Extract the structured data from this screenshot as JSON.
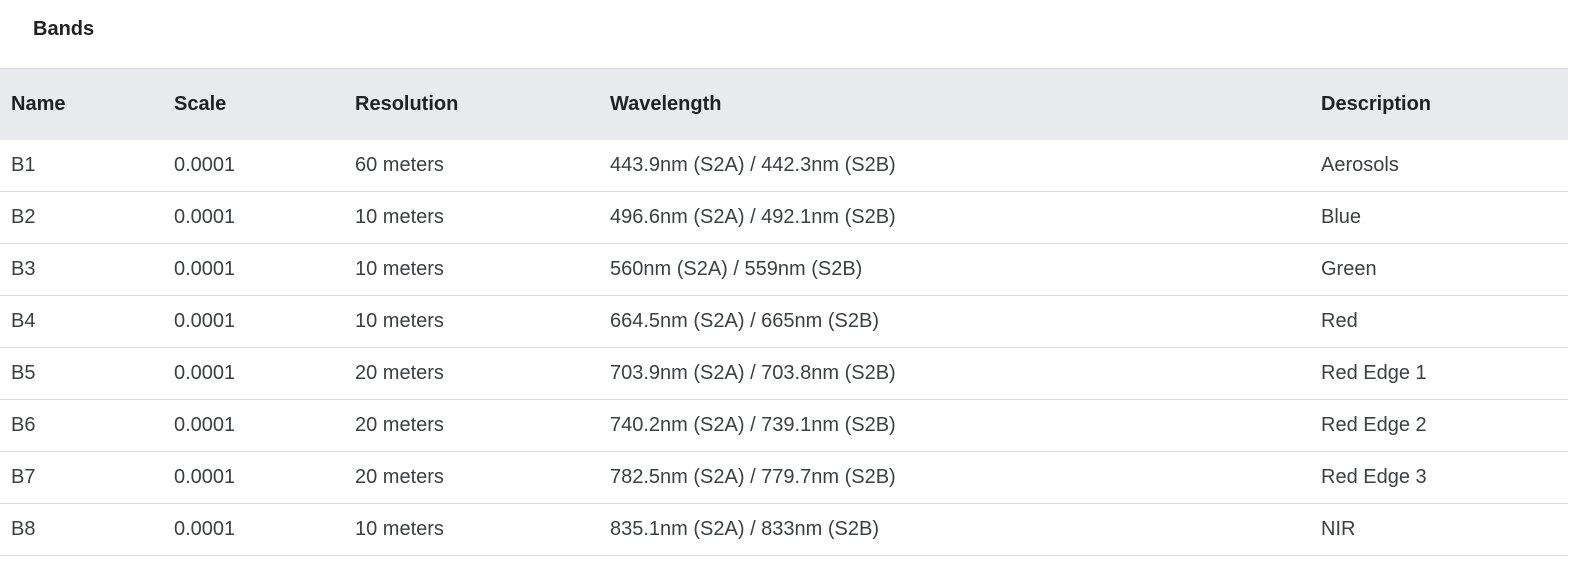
{
  "section": {
    "title": "Bands"
  },
  "table": {
    "headers": {
      "name": "Name",
      "scale": "Scale",
      "resolution": "Resolution",
      "wavelength": "Wavelength",
      "description": "Description"
    },
    "rows": [
      {
        "name": "B1",
        "scale": "0.0001",
        "resolution": "60 meters",
        "wavelength": "443.9nm (S2A) / 442.3nm (S2B)",
        "description": "Aerosols"
      },
      {
        "name": "B2",
        "scale": "0.0001",
        "resolution": "10 meters",
        "wavelength": "496.6nm (S2A) / 492.1nm (S2B)",
        "description": "Blue"
      },
      {
        "name": "B3",
        "scale": "0.0001",
        "resolution": "10 meters",
        "wavelength": "560nm (S2A) / 559nm (S2B)",
        "description": "Green"
      },
      {
        "name": "B4",
        "scale": "0.0001",
        "resolution": "10 meters",
        "wavelength": "664.5nm (S2A) / 665nm (S2B)",
        "description": "Red"
      },
      {
        "name": "B5",
        "scale": "0.0001",
        "resolution": "20 meters",
        "wavelength": "703.9nm (S2A) / 703.8nm (S2B)",
        "description": "Red Edge 1"
      },
      {
        "name": "B6",
        "scale": "0.0001",
        "resolution": "20 meters",
        "wavelength": "740.2nm (S2A) / 739.1nm (S2B)",
        "description": "Red Edge 2"
      },
      {
        "name": "B7",
        "scale": "0.0001",
        "resolution": "20 meters",
        "wavelength": "782.5nm (S2A) / 779.7nm (S2B)",
        "description": "Red Edge 3"
      },
      {
        "name": "B8",
        "scale": "0.0001",
        "resolution": "10 meters",
        "wavelength": "835.1nm (S2A) / 833nm (S2B)",
        "description": "NIR"
      }
    ]
  }
}
